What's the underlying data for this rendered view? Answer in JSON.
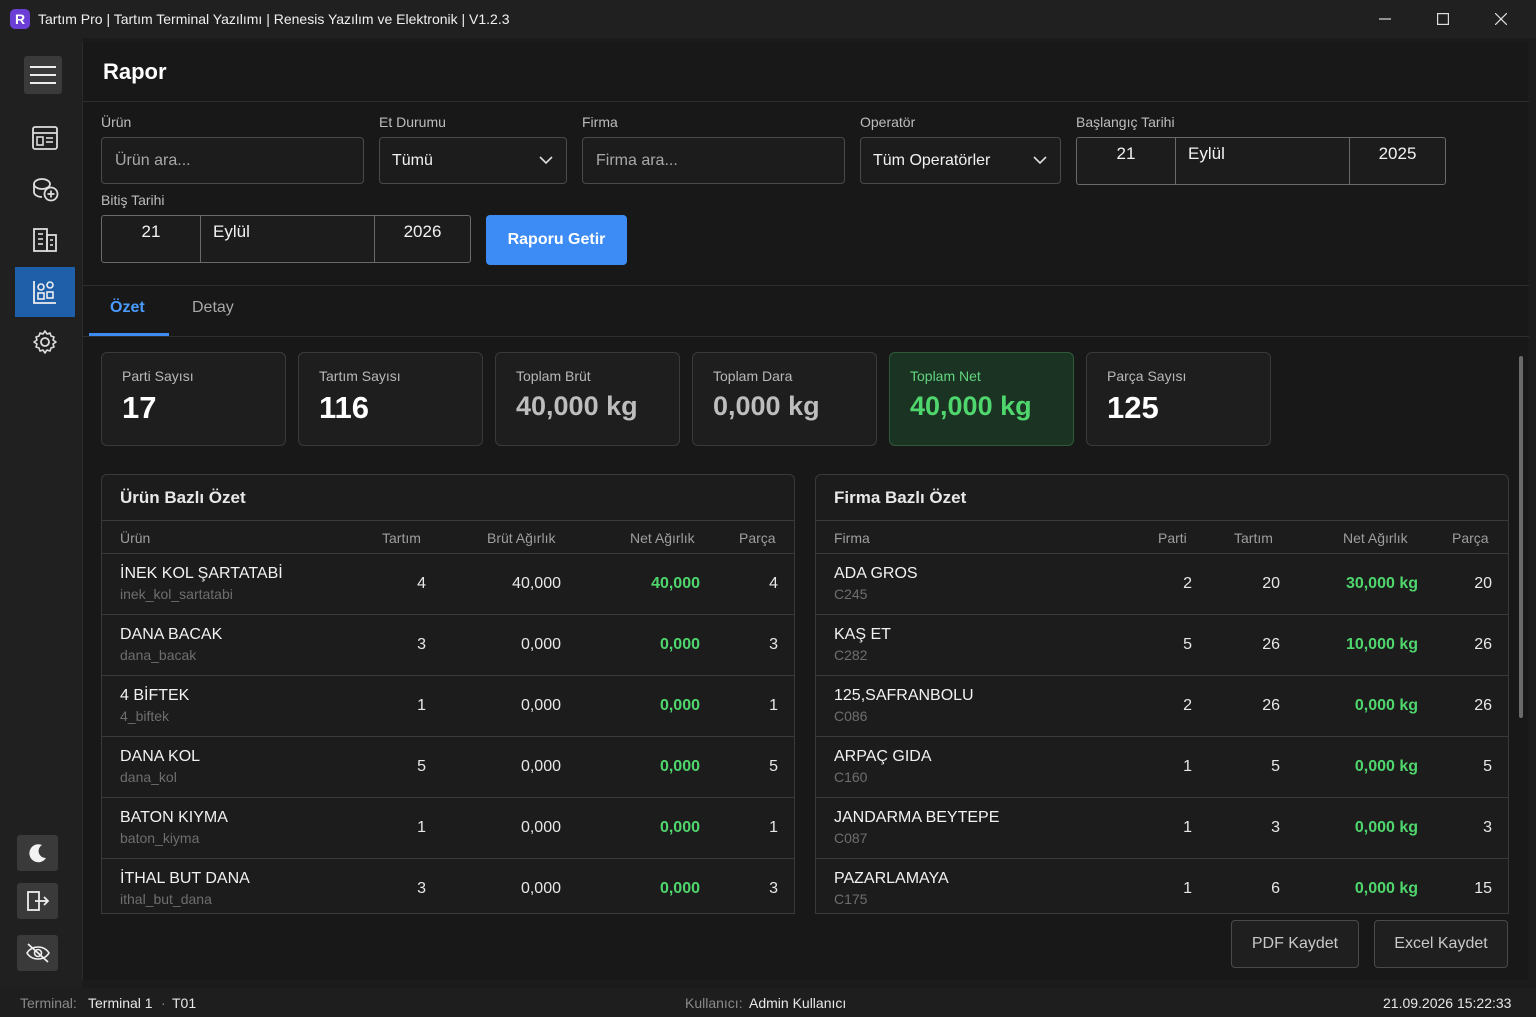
{
  "window": {
    "title": "Tartım Pro | Tartım Terminal Yazılımı | Renesis Yazılım ve Elektronik | V1.2.3",
    "logo_letter": "R"
  },
  "page": {
    "title": "Rapor"
  },
  "filters": {
    "urun": {
      "label": "Ürün",
      "placeholder": "Ürün ara..."
    },
    "et_durumu": {
      "label": "Et Durumu",
      "value": "Tümü"
    },
    "firma": {
      "label": "Firma",
      "placeholder": "Firma ara..."
    },
    "operator": {
      "label": "Operatör",
      "value": "Tüm Operatörler"
    },
    "baslangic": {
      "label": "Başlangıç Tarihi",
      "day": "21",
      "month": "Eylül",
      "year": "2025"
    },
    "bitis": {
      "label": "Bitiş Tarihi",
      "day": "21",
      "month": "Eylül",
      "year": "2026"
    },
    "submit_label": "Raporu Getir"
  },
  "tabs": [
    {
      "label": "Özet",
      "active": true
    },
    {
      "label": "Detay",
      "active": false
    }
  ],
  "cards": [
    {
      "label": "Parti Sayısı",
      "value": "17"
    },
    {
      "label": "Tartım Sayısı",
      "value": "116"
    },
    {
      "label": "Toplam Brüt",
      "value": "40,000 kg"
    },
    {
      "label": "Toplam Dara",
      "value": "0,000 kg"
    },
    {
      "label": "Toplam Net",
      "value": "40,000 kg"
    },
    {
      "label": "Parça Sayısı",
      "value": "125"
    }
  ],
  "urun_ozet": {
    "title": "Ürün Bazlı Özet",
    "columns": [
      "Ürün",
      "Tartım",
      "Brüt Ağırlık",
      "Net Ağırlık",
      "Parça"
    ],
    "rows": [
      {
        "name": " İNEK KOL ŞARTATABİ",
        "code": "inek_kol_sartatabi",
        "tartim": "4",
        "brut": "40,000",
        "net": "40,000",
        "parca": "4"
      },
      {
        "name": "DANA BACAK",
        "code": "dana_bacak",
        "tartim": "3",
        "brut": "0,000",
        "net": "0,000",
        "parca": "3"
      },
      {
        "name": "4 BİFTEK",
        "code": "4_biftek",
        "tartim": "1",
        "brut": "0,000",
        "net": "0,000",
        "parca": "1"
      },
      {
        "name": "DANA KOL",
        "code": "dana_kol",
        "tartim": "5",
        "brut": "0,000",
        "net": "0,000",
        "parca": "5"
      },
      {
        "name": "BATON KIYMA",
        "code": "baton_kiyma",
        "tartim": "1",
        "brut": "0,000",
        "net": "0,000",
        "parca": "1"
      },
      {
        "name": "İTHAL BUT DANA",
        "code": "ithal_but_dana",
        "tartim": "3",
        "brut": "0,000",
        "net": "0,000",
        "parca": "3"
      }
    ]
  },
  "firma_ozet": {
    "title": "Firma Bazlı Özet",
    "columns": [
      "Firma",
      "Parti",
      "Tartım",
      "Net Ağırlık",
      "Parça"
    ],
    "rows": [
      {
        "name": "ADA GROS",
        "code": "C245",
        "parti": "2",
        "tartim": "20",
        "net": "30,000 kg",
        "parca": "20"
      },
      {
        "name": " KAŞ ET",
        "code": "C282",
        "parti": "5",
        "tartim": "26",
        "net": "10,000 kg",
        "parca": "26"
      },
      {
        "name": "125,SAFRANBOLU",
        "code": "C086",
        "parti": "2",
        "tartim": "26",
        "net": "0,000 kg",
        "parca": "26"
      },
      {
        "name": "ARPAÇ GIDA",
        "code": "C160",
        "parti": "1",
        "tartim": "5",
        "net": "0,000 kg",
        "parca": "5"
      },
      {
        "name": "JANDARMA BEYTEPE",
        "code": "C087",
        "parti": "1",
        "tartim": "3",
        "net": "0,000 kg",
        "parca": "3"
      },
      {
        "name": " PAZARLAMAYA",
        "code": "C175",
        "parti": "1",
        "tartim": "6",
        "net": "0,000 kg",
        "parca": "15"
      }
    ]
  },
  "actions": {
    "pdf": "PDF Kaydet",
    "excel": "Excel Kaydet"
  },
  "status": {
    "terminal_label": "Terminal:",
    "terminal_value": "Terminal 1",
    "terminal_sep": "·",
    "terminal_code": "T01",
    "user_label": "Kullanıcı:",
    "user_value": "Admin Kullanıcı",
    "datetime": "21.09.2026 15:22:33"
  },
  "colors": {
    "accent": "#3d8cf5",
    "net_green": "#4fd66d",
    "sidebar_active": "#1f5ea8"
  },
  "icons": [
    "menu-icon",
    "dashboard-icon",
    "add-coins-icon",
    "building-icon",
    "report-icon",
    "gear-icon",
    "moon-icon",
    "logout-icon",
    "eye-off-icon",
    "chevron-down-icon"
  ]
}
